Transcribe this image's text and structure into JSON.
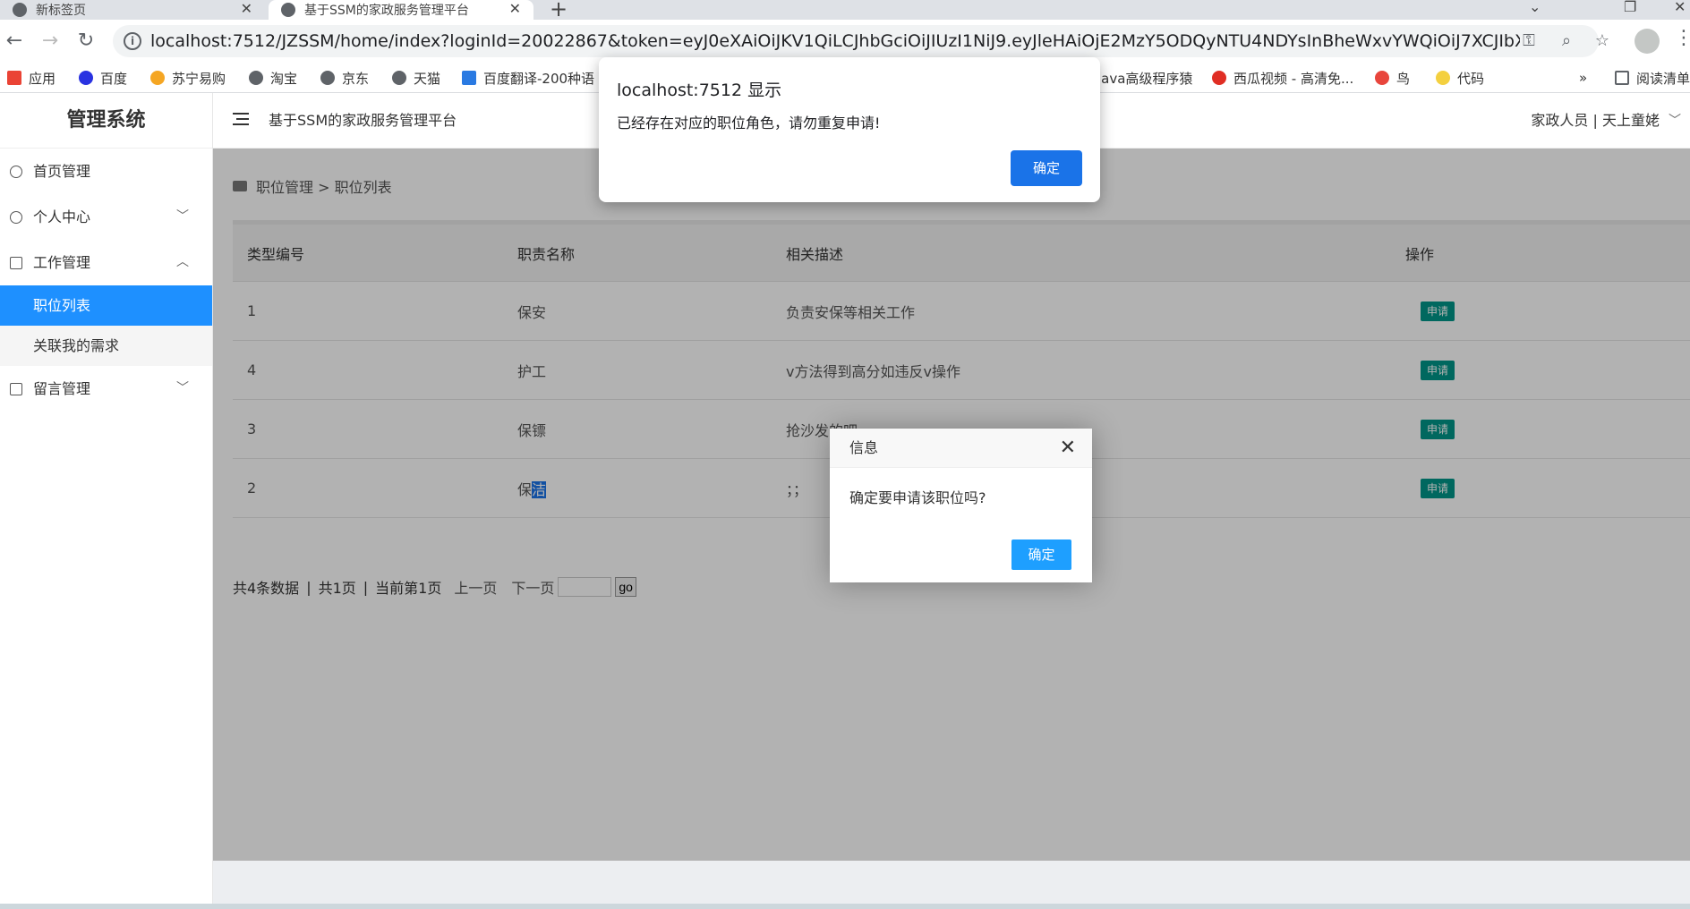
{
  "browser": {
    "tabs": [
      {
        "title": "新标签页"
      },
      {
        "title": "基于SSM的家政服务管理平台"
      }
    ],
    "url": "localhost:7512/JZSSM/home/index?loginId=20022867&token=eyJ0eXAiOiJKV1QiLCJhbGciOiJIUzI1NiJ9.eyJleHAiOjE2MzY5ODQyNTU4NDYsInBheWxvYWQiOiJ7XCJIbXBsb3llckIkXCI...",
    "bookmarks": [
      {
        "label": "应用",
        "color": "#ea4335"
      },
      {
        "label": "百度",
        "color": "#2932e1"
      },
      {
        "label": "苏宁易购",
        "color": "#f5a623"
      },
      {
        "label": "淘宝",
        "color": "#5f6368"
      },
      {
        "label": "京东",
        "color": "#5f6368"
      },
      {
        "label": "天猫",
        "color": "#5f6368"
      },
      {
        "label": "百度翻译-200种语",
        "color": "#2a7ae2"
      },
      {
        "label": "java高级程序猿",
        "color": "#5f6368"
      },
      {
        "label": "西瓜视频 - 高清免...",
        "color": "#e02e24"
      },
      {
        "label": "鸟",
        "color": "#e8453c"
      },
      {
        "label": "代码",
        "color": "#f4d03f"
      }
    ],
    "bookmarks_more": "»",
    "reading_list": "阅读清单"
  },
  "sidebar": {
    "brand": "管理系统",
    "menu": [
      {
        "label": "首页管理"
      },
      {
        "label": "个人中心"
      },
      {
        "label": "工作管理"
      },
      {
        "label": "留言管理"
      }
    ],
    "submenu": [
      {
        "label": "职位列表"
      },
      {
        "label": "关联我的需求"
      }
    ]
  },
  "header": {
    "title": "基于SSM的家政服务管理平台",
    "user": "家政人员 | 天上童姥"
  },
  "breadcrumb": {
    "text": "职位管理 > 职位列表"
  },
  "table": {
    "columns": [
      "类型编号",
      "职责名称",
      "相关描述",
      "操作"
    ],
    "rows": [
      {
        "id": "1",
        "name": "保安",
        "desc": "负责安保等相关工作",
        "action": "申请"
      },
      {
        "id": "4",
        "name": "护工",
        "desc": "v方法得到高分如违反v操作",
        "action": "申请"
      },
      {
        "id": "3",
        "name": "保镖",
        "desc": "抢沙发的吧",
        "action": "申请"
      },
      {
        "id": "2",
        "name_pre": "保",
        "name_sel": "洁",
        "desc": "；；",
        "action": "申请"
      }
    ]
  },
  "pager": {
    "total": "共4条数据",
    "sep": "|",
    "pages": "共1页",
    "current": "当前第1页",
    "prev": "上一页",
    "next": "下一页",
    "go": "go"
  },
  "alert": {
    "title": "localhost:7512 显示",
    "message": "已经存在对应的职位角色，请勿重复申请!",
    "ok": "确定"
  },
  "confirm_layer": {
    "title": "信息",
    "message": "确定要申请该职位吗?",
    "ok": "确定",
    "close": "✕"
  }
}
